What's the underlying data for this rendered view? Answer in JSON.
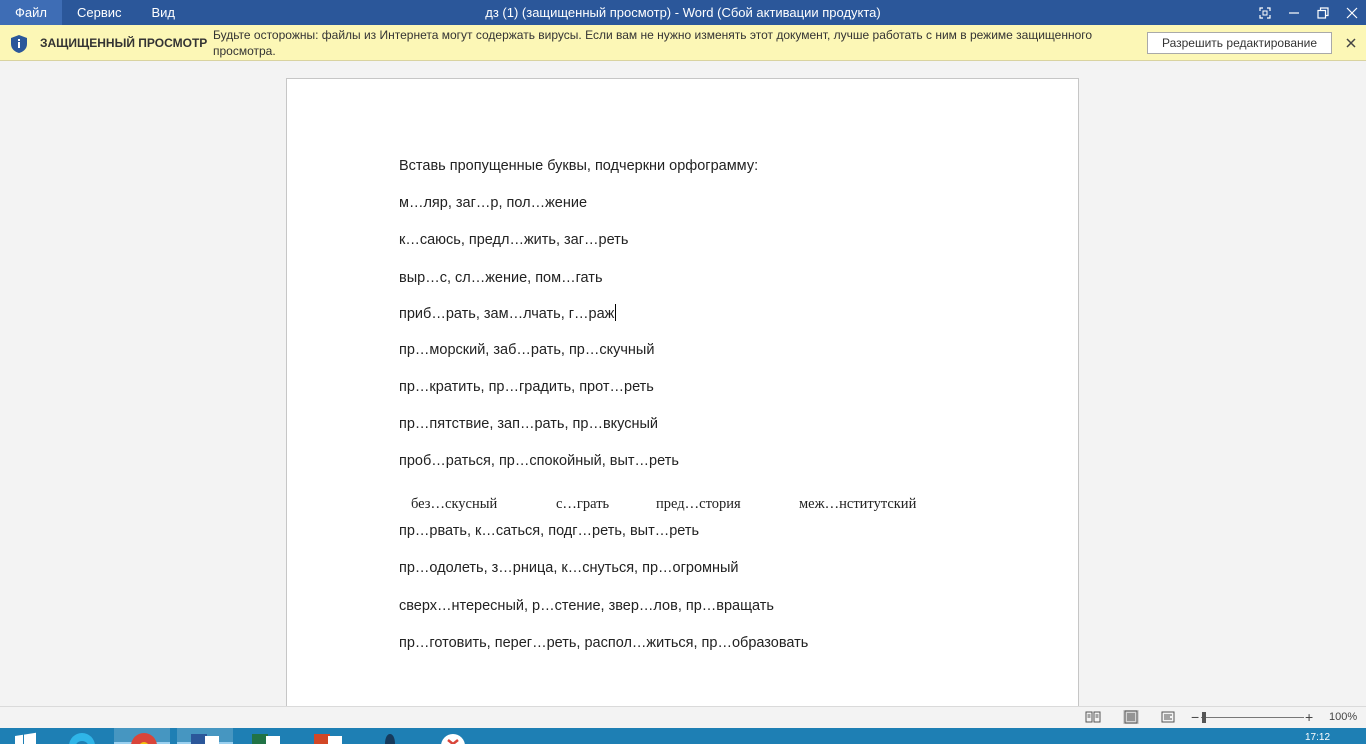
{
  "menu": [
    "Файл",
    "Сервис",
    "Вид"
  ],
  "window_title": "дз (1) (защищенный просмотр) - Word (Сбой активации продукта)",
  "protected_view": {
    "title": "ЗАЩИЩЕННЫЙ ПРОСМОТР",
    "message": "Будьте осторожны: файлы из Интернета могут содержать вирусы. Если вам не нужно изменять этот документ, лучше работать с ним в режиме защищенного просмотра.",
    "enable_editing": "Разрешить редактирование"
  },
  "document": {
    "lines": [
      "Вставь пропущенные буквы, подчеркни орфограмму:",
      "м…ляр, заг…р, пол…жение",
      "к…саюсь, предл…жить, заг…реть",
      "выр…с, сл…жение, пом…гать",
      "приб…рать, зам…лчать, г…раж",
      "пр…морский, заб…рать, пр…скучный",
      "пр…кратить, пр…градить, прот…реть",
      "пр…пятствие, зап…рать, пр…вкусный",
      "проб…раться, пр…спокойный, выт…реть"
    ],
    "serif_words": [
      "без…скусный",
      "с…грать",
      "пред…стория",
      "меж…нститутский"
    ],
    "lines_after": [
      "пр…рвать, к…саться, подг…реть, выт…реть",
      "пр…одолеть, з…рница, к…снуться, пр…огромный",
      "сверх…нтересный, р…стение, звер…лов, пр…вращать",
      "пр…готовить, перег…реть, распол…житься, пр…образовать"
    ]
  },
  "status": {
    "zoom": "100%"
  },
  "taskbar": {
    "time": "17:12"
  },
  "colors": {
    "title_bar": "#2b579a",
    "protected_bar": "#fcf7b6",
    "taskbar": "#1e7fb4"
  }
}
